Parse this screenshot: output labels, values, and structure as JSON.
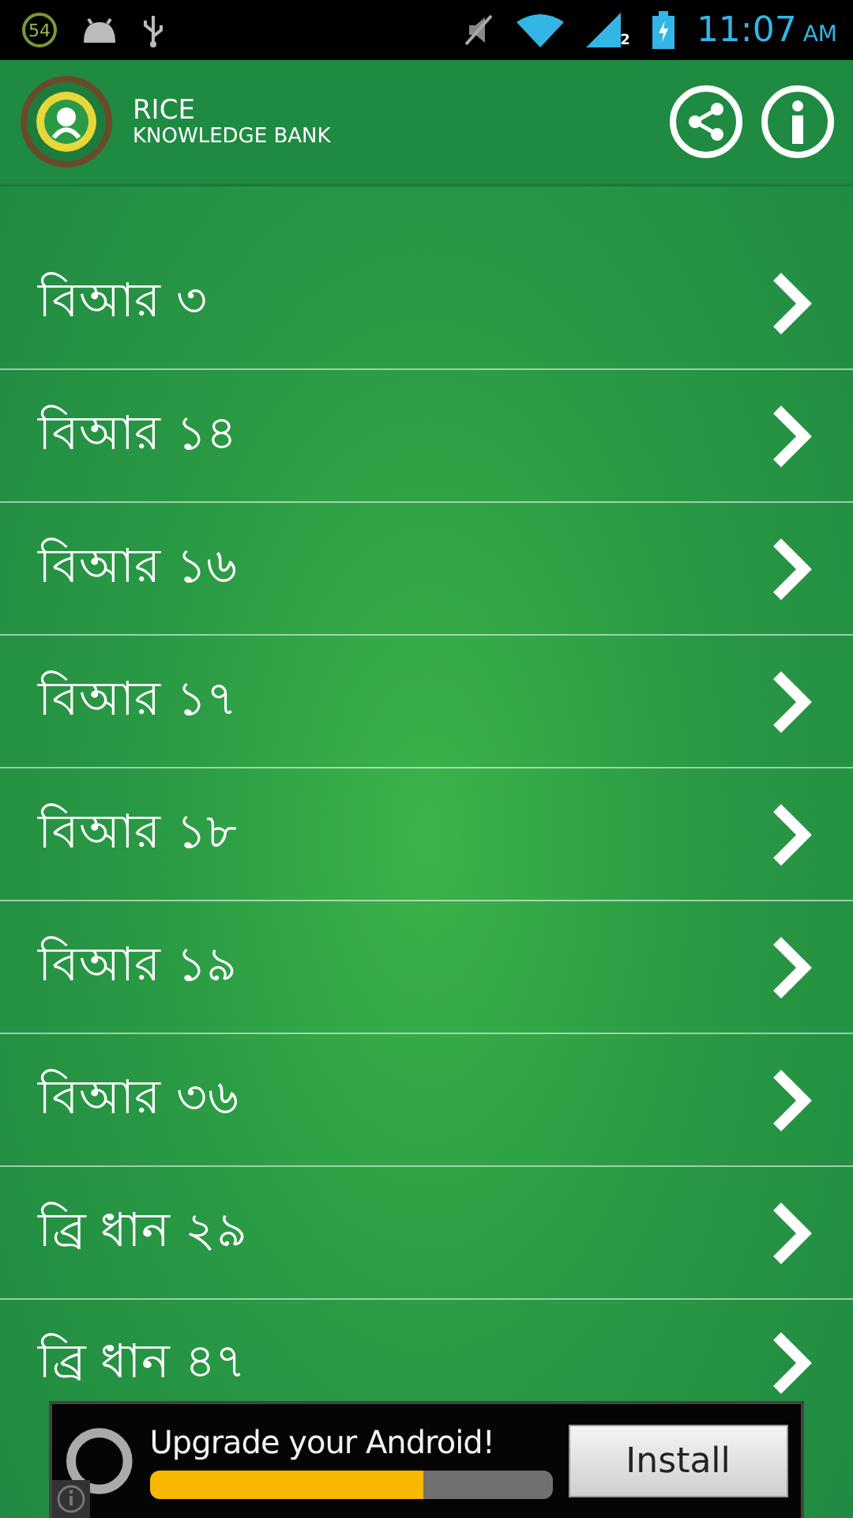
{
  "status_bar": {
    "notification_count": "54",
    "network_badge": "2",
    "time": "11:07",
    "meridiem": "AM"
  },
  "header": {
    "title": "RICE",
    "subtitle": "KNOWLEDGE BANK"
  },
  "varieties": [
    {
      "label": "বিআর ৩"
    },
    {
      "label": "বিআর ১৪"
    },
    {
      "label": "বিআর ১৬"
    },
    {
      "label": "বিআর ১৭"
    },
    {
      "label": "বিআর ১৮"
    },
    {
      "label": "বিআর ১৯"
    },
    {
      "label": "বিআর ৩৬"
    },
    {
      "label": "ব্রি ধান ২৯"
    },
    {
      "label": "ব্রি ধান ৪৭"
    }
  ],
  "ad": {
    "headline": "Upgrade your Android!",
    "level": 0.68,
    "button": "Install"
  }
}
